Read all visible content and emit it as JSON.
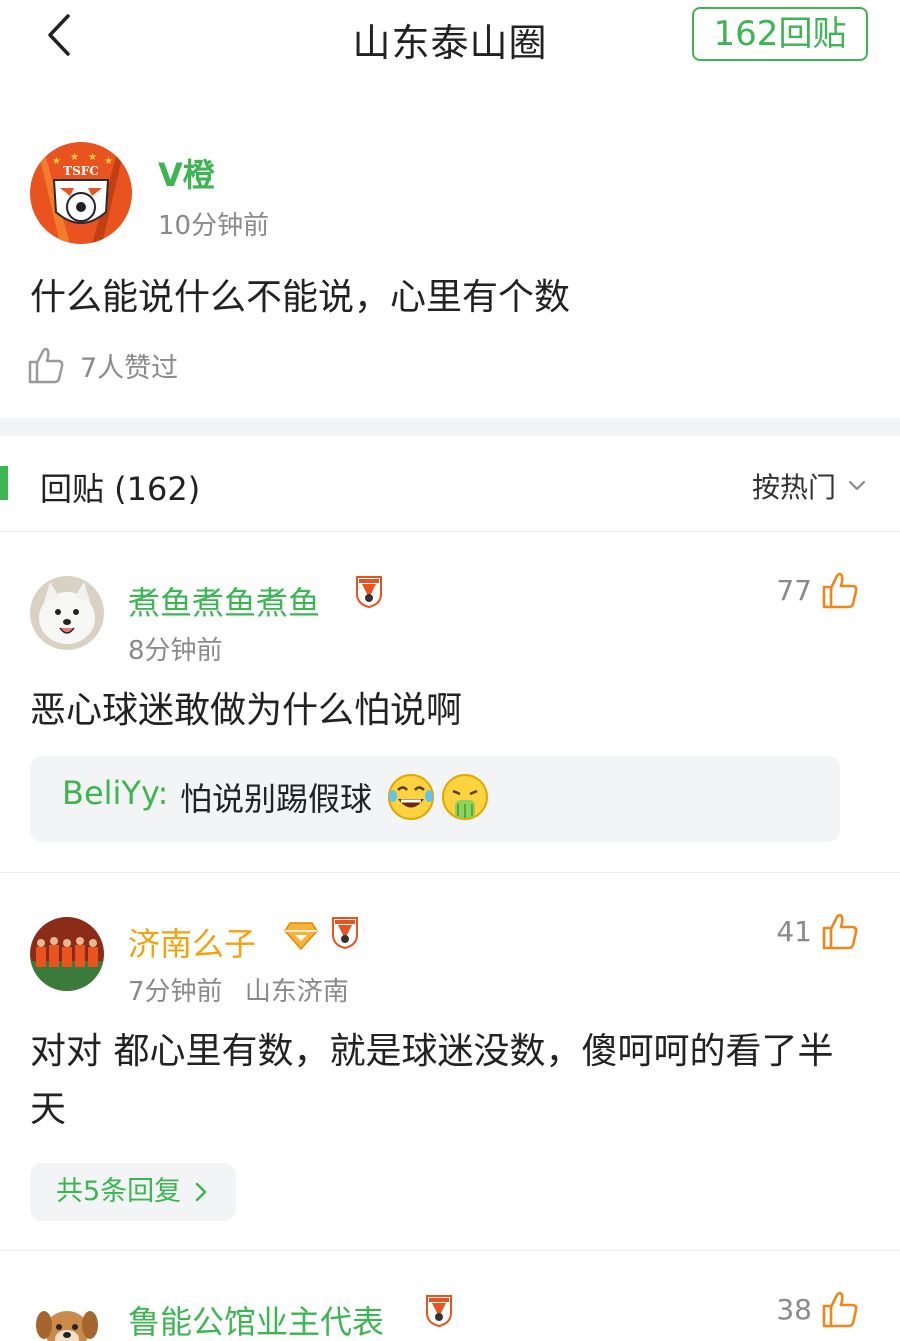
{
  "header": {
    "title": "山东泰山圈",
    "reply_button": "162回贴"
  },
  "post": {
    "username": "V橙",
    "time": "10分钟前",
    "content": "什么能说什么不能说，心里有个数",
    "likes": "7人赞过",
    "avatar_text": "TSFC"
  },
  "replies_bar": {
    "title": "回贴 (162)",
    "sort": "按热门"
  },
  "comments": [
    {
      "username": "煮鱼煮鱼煮鱼",
      "time": "8分钟前",
      "location": "",
      "content": "恶心球迷敢做为什么怕说啊",
      "likes": "77",
      "quote_user": "BeliYy:",
      "quote_text": "怕说别踢假球"
    },
    {
      "username": "济南么子",
      "time": "7分钟前",
      "location": "山东济南",
      "content": "对对 都心里有数，就是球迷没数，傻呵呵的看了半天",
      "likes": "41",
      "more_replies": "共5条回复"
    },
    {
      "username": "鲁能公馆业主代表",
      "likes": "38"
    }
  ],
  "colors": {
    "accent": "#3cb552",
    "like": "#f0861a",
    "gold_user": "#f2a20d"
  }
}
